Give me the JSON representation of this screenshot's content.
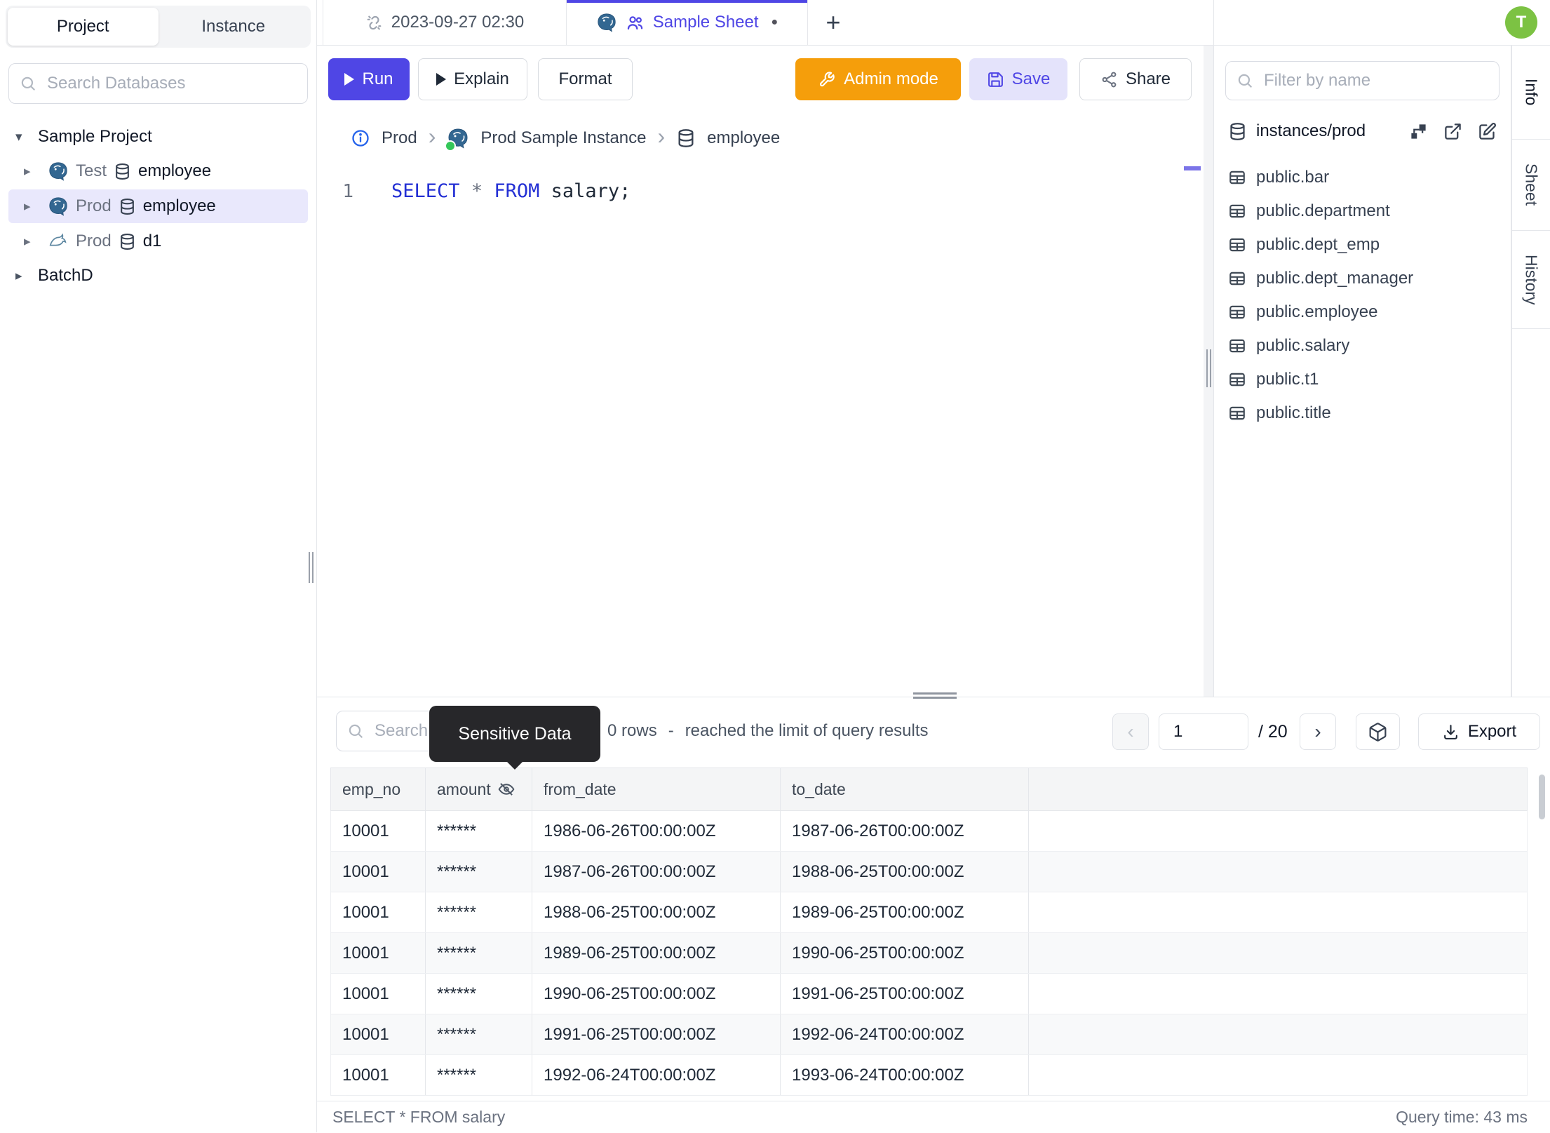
{
  "avatar_initial": "T",
  "sidebar": {
    "tabs": [
      "Project",
      "Instance"
    ],
    "search_placeholder": "Search Databases",
    "tree": {
      "project_label": "Sample Project",
      "connections": [
        {
          "engine": "postgresql",
          "environment": "Test",
          "database": "employee"
        },
        {
          "engine": "postgresql",
          "environment": "Prod",
          "database": "employee"
        },
        {
          "engine": "mysql",
          "environment": "Prod",
          "database": "d1"
        }
      ],
      "batch_label": "BatchD"
    }
  },
  "tab_bar": {
    "history_tab": "2023-09-27 02:30",
    "active_tab": "Sample Sheet"
  },
  "toolbar": {
    "run": "Run",
    "explain": "Explain",
    "format": "Format",
    "admin_mode": "Admin mode",
    "save": "Save",
    "share": "Share"
  },
  "breadcrumb": {
    "environment": "Prod",
    "instance": "Prod Sample Instance",
    "database": "employee"
  },
  "editor": {
    "line_number": "1",
    "tokens": {
      "select": "SELECT",
      "star": "*",
      "from": "FROM",
      "rest": "salary;"
    }
  },
  "schema_panel": {
    "filter_placeholder": "Filter by name",
    "resource": "instances/prod",
    "tables": [
      "public.bar",
      "public.department",
      "public.dept_emp",
      "public.dept_manager",
      "public.employee",
      "public.salary",
      "public.t1",
      "public.title"
    ]
  },
  "side_tabs": {
    "info": "Info",
    "sheet": "Sheet",
    "history": "History"
  },
  "results": {
    "search_placeholder": "Search",
    "tooltip": "Sensitive Data",
    "row_count": "0 rows",
    "dash": "-",
    "limit_message": "reached the limit of query results",
    "pagination": {
      "page": "1",
      "total": "/ 20"
    },
    "export_label": "Export",
    "columns": [
      "emp_no",
      "amount",
      "from_date",
      "to_date"
    ],
    "rows": [
      {
        "emp_no": "10001",
        "amount": "******",
        "from_date": "1986-06-26T00:00:00Z",
        "to_date": "1987-06-26T00:00:00Z"
      },
      {
        "emp_no": "10001",
        "amount": "******",
        "from_date": "1987-06-26T00:00:00Z",
        "to_date": "1988-06-25T00:00:00Z"
      },
      {
        "emp_no": "10001",
        "amount": "******",
        "from_date": "1988-06-25T00:00:00Z",
        "to_date": "1989-06-25T00:00:00Z"
      },
      {
        "emp_no": "10001",
        "amount": "******",
        "from_date": "1989-06-25T00:00:00Z",
        "to_date": "1990-06-25T00:00:00Z"
      },
      {
        "emp_no": "10001",
        "amount": "******",
        "from_date": "1990-06-25T00:00:00Z",
        "to_date": "1991-06-25T00:00:00Z"
      },
      {
        "emp_no": "10001",
        "amount": "******",
        "from_date": "1991-06-25T00:00:00Z",
        "to_date": "1992-06-24T00:00:00Z"
      },
      {
        "emp_no": "10001",
        "amount": "******",
        "from_date": "1992-06-24T00:00:00Z",
        "to_date": "1993-06-24T00:00:00Z"
      }
    ]
  },
  "status_bar": {
    "statement": "SELECT * FROM salary",
    "query_time": "Query time: 43 ms"
  },
  "icons": {
    "caret_down": "▾",
    "caret_right": "▸",
    "plus": "+",
    "chevron_left": "‹",
    "chevron_right": "›",
    "separator": "›",
    "unsaved_dot": "●"
  },
  "colors": {
    "accent": "#4f46e5",
    "admin_orange": "#f59e0b",
    "avatar_green": "#7cc243",
    "sql_keyword": "#2430d4",
    "selected_row_bg": "#e9e8fc",
    "tooltip_bg": "#27272a"
  }
}
